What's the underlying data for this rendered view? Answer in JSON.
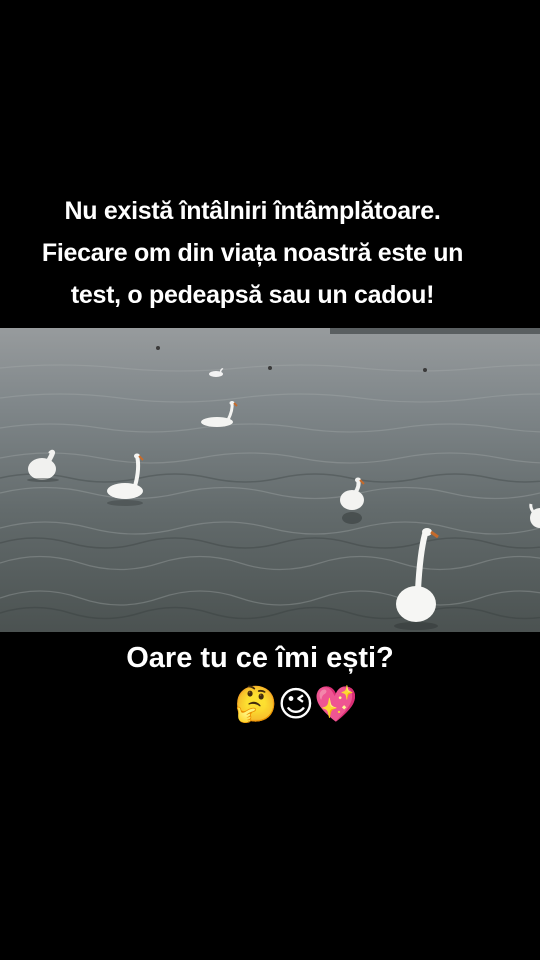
{
  "quote": {
    "line1": "Nu există întâlniri întâmplătoare.",
    "line2": "Fiecare om din viața noastră este un",
    "line3": "test, o pedeapsă sau un cadou!"
  },
  "photo": {
    "subject": "swans-on-lake",
    "water_color": "#6f7577"
  },
  "question": {
    "text": "Oare tu ce îmi ești?",
    "emojis": "🤔😉💖"
  }
}
